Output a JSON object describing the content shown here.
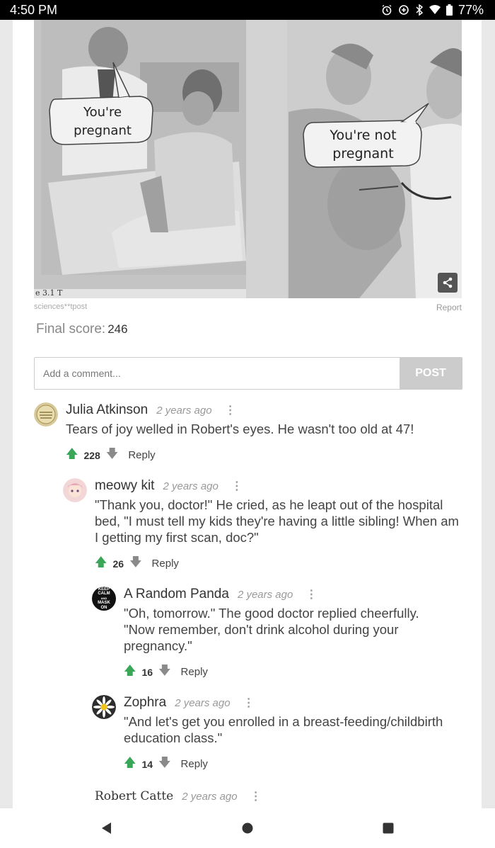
{
  "status": {
    "time": "4:50 PM",
    "battery": "77%"
  },
  "meme": {
    "left_caption": [
      "You're",
      "pregnant"
    ],
    "right_caption": [
      "You're not",
      "pregnant"
    ],
    "book_fragment": "e 3.1 T"
  },
  "post": {
    "credit": "sciences**tpost",
    "report": "Report",
    "final_score_label": "Final score:",
    "final_score_value": "246"
  },
  "comment_form": {
    "placeholder": "Add a comment...",
    "post_label": "POST"
  },
  "comments": [
    {
      "author": "Julia Atkinson",
      "time": "2 years ago",
      "text": "Tears of joy welled in Robert's eyes. He wasn't too old at 47!",
      "score": "228",
      "reply": "Reply"
    },
    {
      "author": "meowy kit",
      "time": "2 years ago",
      "text": "\"Thank you, doctor!\" He cried, as he leapt out of the hospital bed, \"I must tell my kids they're having a little sibling! When am I getting my first scan, doc?\"",
      "score": "26",
      "reply": "Reply"
    },
    {
      "author": "A Random Panda",
      "time": "2 years ago",
      "text": "\"Oh, tomorrow.\" The good doctor replied cheerfully. \"Now remember, don't drink alcohol during your pregnancy.\"",
      "score": "16",
      "reply": "Reply"
    },
    {
      "author": "Zophra",
      "time": "2 years ago",
      "text": "\"And let's get you enrolled in a breast-feeding/childbirth education class.\"",
      "score": "14",
      "reply": "Reply"
    },
    {
      "author": "Robert Catte",
      "time": "2 years ago"
    }
  ],
  "avatar_text": {
    "panda": [
      "KEEP",
      "CALM",
      "AND",
      "MASK",
      "ON"
    ]
  },
  "icons": {
    "vote_up": "arrow-up-icon",
    "vote_down": "arrow-down-icon",
    "more": "more-vert-icon",
    "share": "share-icon"
  },
  "colors": {
    "upvote": "#3aa657",
    "post_button": "#cccccc"
  }
}
